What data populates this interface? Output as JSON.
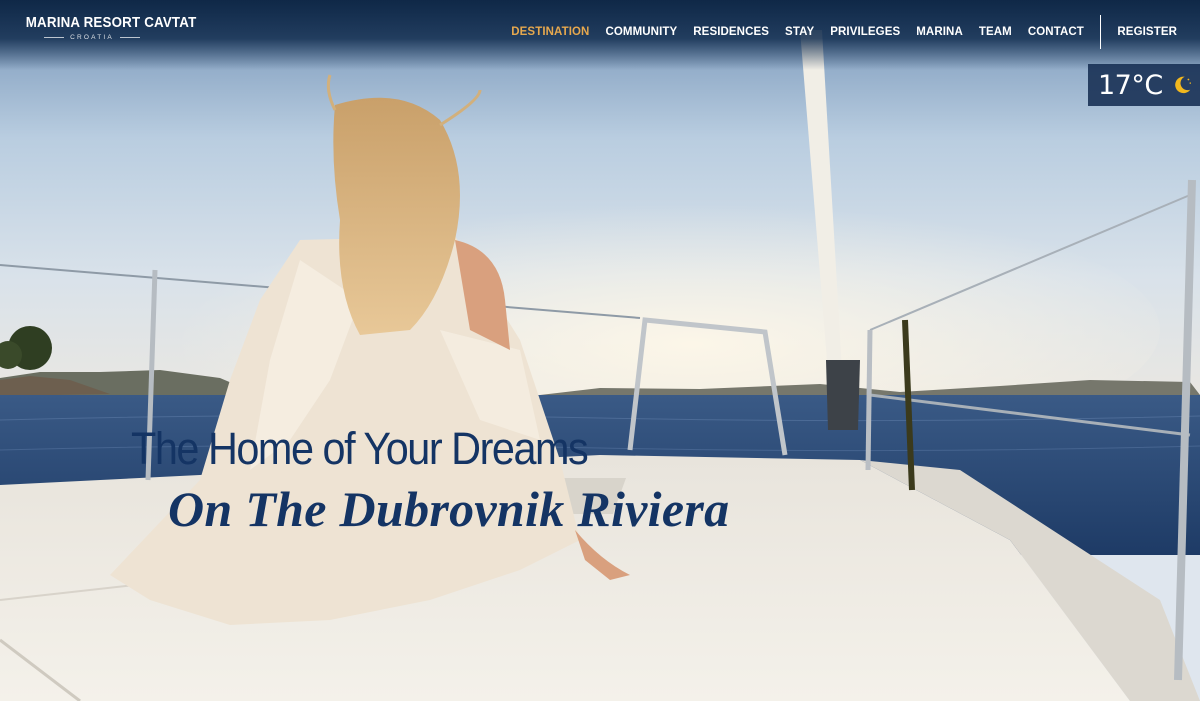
{
  "brand": {
    "name": "MARINA RESORT CAVTAT",
    "sub": "CROATIA"
  },
  "nav": {
    "items": [
      {
        "label": "DESTINATION",
        "active": true
      },
      {
        "label": "COMMUNITY"
      },
      {
        "label": "RESIDENCES"
      },
      {
        "label": "STAY"
      },
      {
        "label": "PRIVILEGES"
      },
      {
        "label": "MARINA"
      },
      {
        "label": "TEAM"
      },
      {
        "label": "CONTACT"
      }
    ],
    "register": "REGISTER"
  },
  "weather": {
    "temperature": "17°C",
    "icon": "moon-icon"
  },
  "hero": {
    "headline": "The Home of Your Dreams",
    "subline": "On The Dubrovnik Riviera"
  },
  "colors": {
    "accent": "#e6a84e",
    "navy": "#143464"
  }
}
